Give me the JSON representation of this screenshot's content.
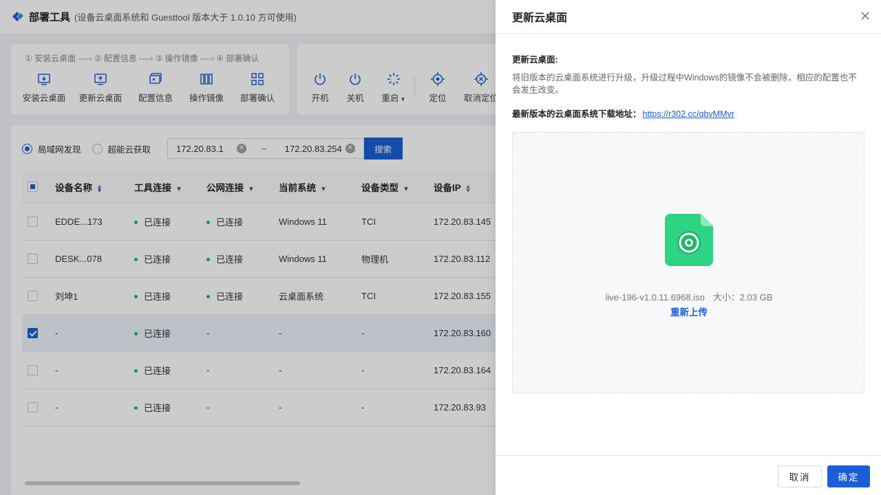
{
  "app": {
    "title": "部署工具",
    "subtitle": "(设备云桌面系统和 Guesttool 版本大于 1.0.10 方可使用)"
  },
  "toolbar": {
    "steps": "① 安装云桌面 ----› ② 配置信息 ----› ③ 操作镜像 ----› ④ 部署确认",
    "left_buttons": [
      "安装云桌面",
      "更新云桌面",
      "配置信息",
      "操作镜像",
      "部署确认"
    ],
    "right_buttons": [
      "开机",
      "关机",
      "重启",
      "定位",
      "取消定位"
    ]
  },
  "filter": {
    "radio_lan": "局域网发现",
    "radio_cloud": "超能云获取",
    "ip_start": "172.20.83.1",
    "ip_end": "172.20.83.254",
    "tilde": "~",
    "search": "搜索"
  },
  "table": {
    "headers": {
      "name": "设备名称",
      "tool": "工具连接",
      "public": "公网连接",
      "system": "当前系统",
      "type": "设备类型",
      "ip": "设备IP"
    },
    "rows": [
      {
        "name": "EDDE...173",
        "tool": "已连接",
        "public": "已连接",
        "system": "Windows 11",
        "type": "TCI",
        "ip": "172.20.83.145"
      },
      {
        "name": "DESK...078",
        "tool": "已连接",
        "public": "已连接",
        "system": "Windows 11",
        "type": "物理机",
        "ip": "172.20.83.112"
      },
      {
        "name": "刘坤1",
        "tool": "已连接",
        "public": "已连接",
        "system": "云桌面系统",
        "type": "TCI",
        "ip": "172.20.83.155"
      },
      {
        "name": "-",
        "tool": "已连接",
        "public": "-",
        "system": "-",
        "type": "-",
        "ip": "172.20.83.160"
      },
      {
        "name": "-",
        "tool": "已连接",
        "public": "-",
        "system": "-",
        "type": "-",
        "ip": "172.20.83.164"
      },
      {
        "name": "-",
        "tool": "已连接",
        "public": "-",
        "system": "-",
        "type": "-",
        "ip": "172.20.83.93"
      }
    ]
  },
  "drawer": {
    "title": "更新云桌面",
    "section_title": "更新云桌面:",
    "section_desc": "将旧版本的云桌面系统进行升级，升级过程中Windows的镜像不会被删除，相应的配置也不会发生改变。",
    "download_label": "最新版本的云桌面系统下载地址：",
    "download_link": "https://r302.cc/qbvMMvr",
    "file_name": "live-196-v1.0.11.6968.iso",
    "file_size": "大小：2.03 GB",
    "reupload": "重新上传",
    "cancel": "取消",
    "confirm": "确定"
  },
  "colors": {
    "primary": "#1a5fd6",
    "success": "#1fb36b",
    "file_icon": "#2fd384"
  }
}
